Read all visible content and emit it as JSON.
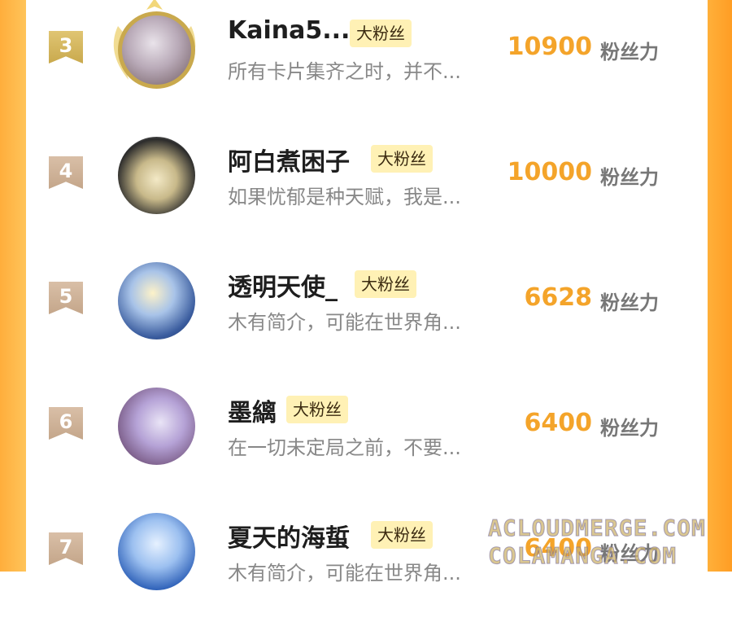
{
  "rows": [
    {
      "rank": "3",
      "name": "Kaina5...",
      "badge": "大粉丝",
      "bio": "所有卡片集齐之时，并不...",
      "score": "10900",
      "unit": "粉丝力"
    },
    {
      "rank": "4",
      "name": "阿白煮困子",
      "badge": "大粉丝",
      "bio": "如果忧郁是种天赋，我是...",
      "score": "10000",
      "unit": "粉丝力"
    },
    {
      "rank": "5",
      "name": "透明天使_",
      "badge": "大粉丝",
      "bio": "木有简介，可能在世界角...",
      "score": "6628",
      "unit": "粉丝力"
    },
    {
      "rank": "6",
      "name": "墨縭",
      "badge": "大粉丝",
      "bio": "在一切未定局之前，不要...",
      "score": "6400",
      "unit": "粉丝力"
    },
    {
      "rank": "7",
      "name": "夏天的海蜇",
      "badge": "大粉丝",
      "bio": "木有简介，可能在世界角...",
      "score": "6400",
      "unit": "粉丝力"
    }
  ],
  "watermarks": [
    "ACLOUDMERGE.COM",
    "COLAMANGA.COM"
  ],
  "colors": {
    "frame": "#ffae3c",
    "score": "#f4a42a",
    "badge_bg": "#fff1b5",
    "rank_gold": "#c9a94d",
    "rank_plain": "#c4a68a"
  }
}
